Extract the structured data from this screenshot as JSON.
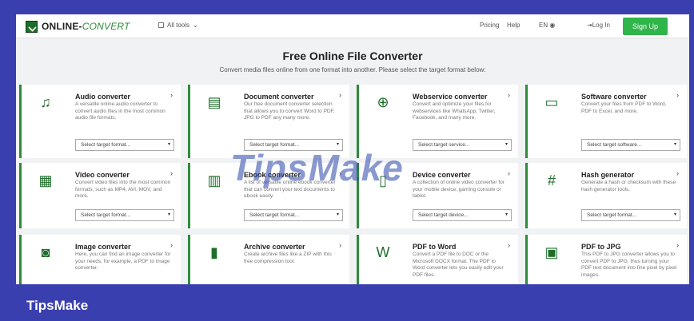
{
  "header": {
    "logo_main": "ONLINE-",
    "logo_alt": "CONVERT",
    "all_tools": "All tools",
    "pricing": "Pricing",
    "help": "Help",
    "lang": "EN",
    "login": "Log In",
    "signup": "Sign Up"
  },
  "hero": {
    "title": "Free Online File Converter",
    "subtitle": "Convert media files online from one format into another. Please select the target format below:"
  },
  "cards": [
    {
      "title": "Audio converter",
      "desc": "A versatile online audio converter to convert audio files in the most common audio file formats.",
      "select": "Select target format...",
      "icon": "music-note-icon"
    },
    {
      "title": "Document converter",
      "desc": "Our free document converter selection that allows you to convert Word to PDF, JPG to PDF any many more.",
      "select": "Select target format...",
      "icon": "document-icon"
    },
    {
      "title": "Webservice converter",
      "desc": "Convert and optimize your files for webservices like WhatsApp, Twitter, Facebook, and many more.",
      "select": "Select target service...",
      "icon": "globe-icon"
    },
    {
      "title": "Software converter",
      "desc": "Convert your files from PDF to Word, PDF to Excel, and more.",
      "select": "Select target software...",
      "icon": "monitor-icon"
    },
    {
      "title": "Video converter",
      "desc": "Convert video files into the most common formats, such as MP4, AVI, MOV, and more.",
      "select": "Select target format...",
      "icon": "film-icon"
    },
    {
      "title": "Ebook converter",
      "desc": "A list of versatile online ebook converter that can convert your text documents to ebook easily.",
      "select": "Select target format...",
      "icon": "books-icon"
    },
    {
      "title": "Device converter",
      "desc": "A collection of online video converter for your mobile device, gaming console or tablet.",
      "select": "Select target device...",
      "icon": "tablet-icon"
    },
    {
      "title": "Hash generator",
      "desc": "Generate a hash or checksum with these hash generator tools.",
      "select": "Select target format...",
      "icon": "hash-icon"
    },
    {
      "title": "Image converter",
      "desc": "Here, you can find an image converter for your needs, for example, a PDF to image converter.",
      "select": "",
      "icon": "camera-icon"
    },
    {
      "title": "Archive converter",
      "desc": "Create archive files like a ZIP with this free compression tool.",
      "select": "",
      "icon": "archive-icon"
    },
    {
      "title": "PDF to Word",
      "desc": "Convert a PDF file to DOC or the Microsoft DOCX format. The PDF to Word converter lets you easily edit your PDF files.",
      "select": "",
      "icon": "word-file-icon"
    },
    {
      "title": "PDF to JPG",
      "desc": "This PDF to JPG converter allows you to convert PDF to JPG, thus turning your PDF text document into fine pixel by pixel images.",
      "select": "",
      "icon": "image-file-icon"
    }
  ],
  "watermark": "TipsMake",
  "brand": "TipsMake",
  "colors": {
    "accent": "#2e8b3a",
    "signup": "#2fb54a",
    "frame": "#3a3fb0"
  }
}
